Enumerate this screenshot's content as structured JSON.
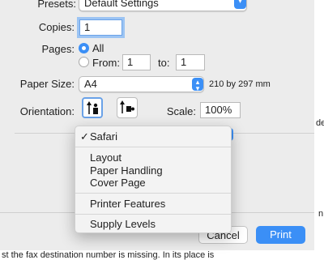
{
  "presets": {
    "label": "Presets:",
    "value": "Default Settings"
  },
  "copies": {
    "label": "Copies:",
    "value": "1"
  },
  "pages": {
    "label": "Pages:",
    "all_label": "All",
    "from_label": "From:",
    "from_value": "1",
    "to_label": "to:",
    "to_value": "1"
  },
  "paper_size": {
    "label": "Paper Size:",
    "value": "A4",
    "dimensions": "210 by 297 mm"
  },
  "orientation": {
    "label": "Orientation:"
  },
  "scale": {
    "label": "Scale:",
    "value": "100%"
  },
  "menu": {
    "checkmark": "✓",
    "selected": "Safari",
    "items": [
      "Layout",
      "Paper Handling",
      "Cover Page",
      "Printer Features",
      "Supply Levels"
    ]
  },
  "footer": {
    "cancel_label": "Cancel",
    "print_label": "Print"
  },
  "background_text": {
    "right_edge_1": "de",
    "right_edge_2": "n",
    "bottom": "st the fax destination number is missing. In its place is"
  },
  "colors": {
    "accent": "#3b8ff6",
    "focus_ring": "#9cc4f3"
  }
}
